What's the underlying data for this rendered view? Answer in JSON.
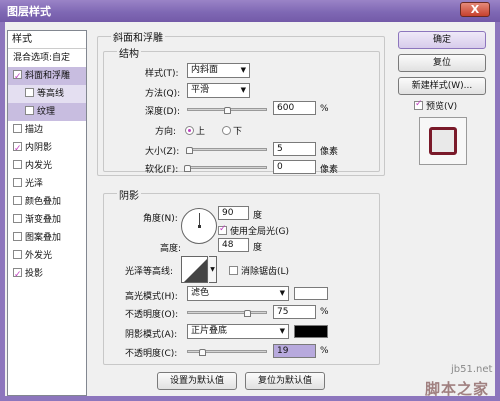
{
  "window": {
    "title": "图层样式",
    "close_label": "X"
  },
  "sidebar": {
    "header": "样式",
    "items": [
      {
        "label": "混合选项:自定",
        "checkbox": false,
        "checked": false,
        "selected": false
      },
      {
        "label": "斜面和浮雕",
        "checkbox": true,
        "checked": true,
        "selected": true
      },
      {
        "label": "等高线",
        "checkbox": true,
        "checked": false,
        "selected": false,
        "sub": true
      },
      {
        "label": "纹理",
        "checkbox": true,
        "checked": false,
        "selected": true,
        "sub": true
      },
      {
        "label": "描边",
        "checkbox": true,
        "checked": false,
        "selected": false
      },
      {
        "label": "内阴影",
        "checkbox": true,
        "checked": true,
        "selected": false
      },
      {
        "label": "内发光",
        "checkbox": true,
        "checked": false,
        "selected": false
      },
      {
        "label": "光泽",
        "checkbox": true,
        "checked": false,
        "selected": false
      },
      {
        "label": "颜色叠加",
        "checkbox": true,
        "checked": false,
        "selected": false
      },
      {
        "label": "渐变叠加",
        "checkbox": true,
        "checked": false,
        "selected": false
      },
      {
        "label": "图案叠加",
        "checkbox": true,
        "checked": false,
        "selected": false
      },
      {
        "label": "外发光",
        "checkbox": true,
        "checked": false,
        "selected": false
      },
      {
        "label": "投影",
        "checkbox": true,
        "checked": true,
        "selected": false
      }
    ]
  },
  "bevel": {
    "group_title": "斜面和浮雕",
    "structure_title": "结构",
    "style_label": "样式(T):",
    "style_value": "内斜面",
    "method_label": "方法(Q):",
    "method_value": "平滑",
    "depth_label": "深度(D):",
    "depth_value": "600",
    "depth_unit": "%",
    "depth_fraction": 0.5,
    "direction_label": "方向:",
    "direction_up": "上",
    "direction_down": "下",
    "size_label": "大小(Z):",
    "size_value": "5",
    "size_unit": "像素",
    "size_fraction": 0.02,
    "soften_label": "软化(F):",
    "soften_value": "0",
    "soften_unit": "像素",
    "soften_fraction": 0.0
  },
  "shading": {
    "title": "阴影",
    "angle_label": "角度(N):",
    "angle_value": "90",
    "angle_unit": "度",
    "global_light_label": "使用全局光(G)",
    "altitude_label": "高度:",
    "altitude_value": "48",
    "altitude_unit": "度",
    "gloss_label": "光泽等高线:",
    "antialias_label": "消除锯齿(L)",
    "highlight_label": "高光模式(H):",
    "highlight_value": "滤色",
    "highlight_opacity_label": "不透明度(O):",
    "highlight_opacity_value": "75",
    "highlight_opacity_fraction": 0.75,
    "shadow_label": "阴影模式(A):",
    "shadow_value": "正片叠底",
    "shadow_opacity_label": "不透明度(C):",
    "shadow_opacity_value": "19",
    "shadow_opacity_fraction": 0.19,
    "opacity_unit": "%",
    "highlight_color": "#ffffff",
    "shadow_color": "#000000"
  },
  "footer": {
    "default_button": "设置为默认值",
    "reset_button": "复位为默认值"
  },
  "right": {
    "ok": "确定",
    "reset": "复位",
    "new_style": "新建样式(W)...",
    "preview_label": "预览(V)",
    "preview_color": "#7a1a2a"
  },
  "watermark": {
    "site": "jb51.net",
    "brand": "脚本之家"
  }
}
